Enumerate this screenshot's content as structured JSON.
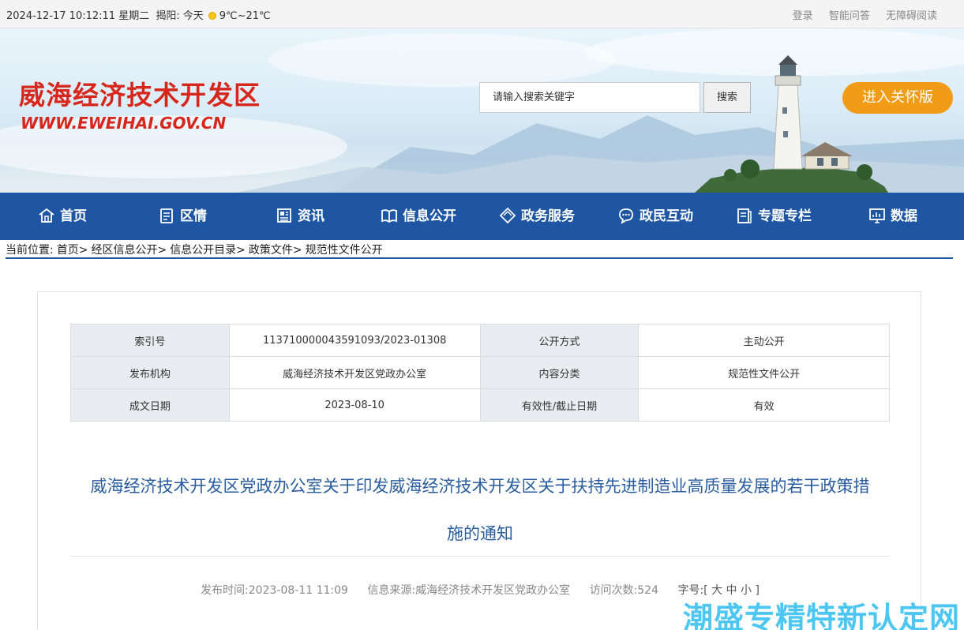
{
  "topbar": {
    "datetime": "2024-12-17 10:12:11 星期二",
    "location": "揭阳:",
    "today": "今天",
    "temperature": "9℃~21℃",
    "links": [
      "登录",
      "智能问答",
      "无障碍阅读"
    ]
  },
  "header": {
    "site_name": "威海经济技术开发区",
    "site_url": "WWW.EWEIHAI.GOV.CN",
    "search_placeholder": "请输入搜索关键字",
    "search_button": "搜索",
    "care_button": "进入关怀版"
  },
  "nav": [
    {
      "label": "首页",
      "icon": "home-icon"
    },
    {
      "label": "区情",
      "icon": "document-icon"
    },
    {
      "label": "资讯",
      "icon": "news-icon"
    },
    {
      "label": "信息公开",
      "icon": "book-icon"
    },
    {
      "label": "政务服务",
      "icon": "diamond-icon"
    },
    {
      "label": "政民互动",
      "icon": "chat-icon"
    },
    {
      "label": "专题专栏",
      "icon": "column-icon"
    },
    {
      "label": "数据",
      "icon": "chart-icon"
    }
  ],
  "breadcrumb": {
    "prefix": "当前位置:",
    "items": [
      "首页>",
      "经区信息公开>",
      "信息公开目录>",
      "政策文件>",
      "规范性文件公开"
    ]
  },
  "meta": {
    "rows": [
      [
        "索引号",
        "113710000043591093/2023-01308",
        "公开方式",
        "主动公开"
      ],
      [
        "发布机构",
        "威海经济技术开发区党政办公室",
        "内容分类",
        "规范性文件公开"
      ],
      [
        "成文日期",
        "2023-08-10",
        "有效性/截止日期",
        "有效"
      ]
    ]
  },
  "article": {
    "title_line1": "威海经济技术开发区党政办公室关于印发威海经济技术开发区关于扶持先进制造业高质量发展的若干政策措",
    "title_line2": "施的通知",
    "publish_time": "发布时间:2023-08-11 11:09",
    "source": "信息来源:威海经济技术开发区党政办公室",
    "visits": "访问次数:524",
    "font_size": "字号:[ 大 中 小 ]"
  },
  "watermark": "潮盛专精特新认定网",
  "colors": {
    "brand_red": "#d7261c",
    "nav_blue": "#1f56a4",
    "care_orange": "#f29b17",
    "title_blue": "#2a5d9f"
  }
}
